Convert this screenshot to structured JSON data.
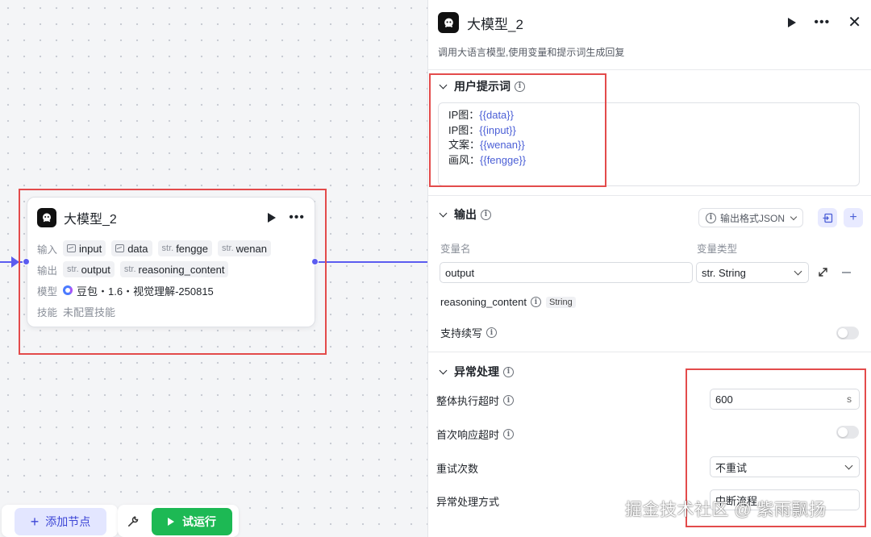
{
  "node": {
    "title": "大模型_2",
    "input_label": "输入",
    "inputs": [
      {
        "name": "input",
        "kind": "image"
      },
      {
        "name": "data",
        "kind": "image"
      },
      {
        "name": "fengge",
        "kind": "str"
      },
      {
        "name": "wenan",
        "kind": "str"
      }
    ],
    "output_label": "输出",
    "outputs": [
      "output",
      "reasoning_content"
    ],
    "str_prefix": "str.",
    "model_label": "模型",
    "model_value": "豆包・1.6・视觉理解-250815",
    "skill_label": "技能",
    "skill_value": "未配置技能"
  },
  "toolbar": {
    "add_node": "添加节点",
    "run": "试运行"
  },
  "panel": {
    "title": "大模型_2",
    "description": "调用大语言模型,使用变量和提示词生成回复",
    "user_prompt": {
      "title": "用户提示词",
      "lines": [
        {
          "label": "IP图：",
          "var": "{{data}}"
        },
        {
          "label": "IP图：",
          "var": "{{input}}"
        },
        {
          "label": "文案：",
          "var": "{{wenan}}"
        },
        {
          "label": "画风：",
          "var": "{{fengge}}"
        }
      ]
    },
    "output": {
      "title": "输出",
      "format_button": "输出格式JSON",
      "col_var_name": "变量名",
      "col_var_type": "变量类型",
      "var_name_value": "output",
      "var_type_value": "str. String",
      "reasoning_name": "reasoning_content",
      "reasoning_type": "String",
      "continue_label": "支持续写",
      "continue_enabled": false
    },
    "exception": {
      "title": "异常处理",
      "timeout_label": "整体执行超时",
      "timeout_value": "600",
      "timeout_unit": "s",
      "first_response_label": "首次响应超时",
      "first_response_enabled": false,
      "retry_label": "重试次数",
      "retry_value": "不重试",
      "handling_label": "异常处理方式",
      "handling_value": "中断流程"
    }
  },
  "watermark": "掘金技术社区 @ 紫雨飘扬",
  "colors": {
    "accent": "#5b5cf0",
    "run_green": "#1db954",
    "highlight_red": "#e34b4b",
    "variable_blue": "#4b5fd6"
  }
}
